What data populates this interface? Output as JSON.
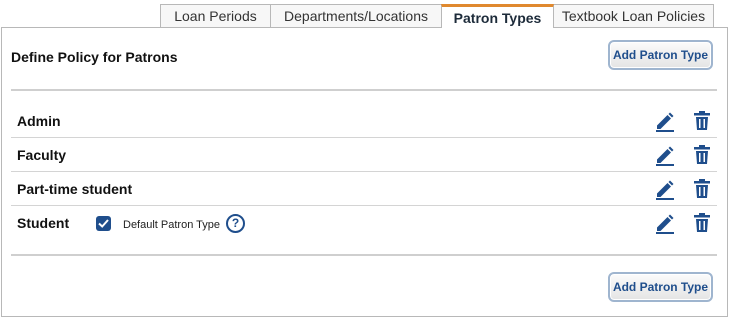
{
  "tabs": [
    {
      "label": "Loan Periods",
      "active": false
    },
    {
      "label": "Departments/Locations",
      "active": false
    },
    {
      "label": "Patron Types",
      "active": true
    },
    {
      "label": "Textbook Loan Policies",
      "active": false
    }
  ],
  "panel": {
    "title": "Define Policy for Patrons",
    "add_button_top": "Add Patron Type",
    "add_button_bottom": "Add Patron Type"
  },
  "patron_types": [
    {
      "name": "Admin",
      "is_default": false
    },
    {
      "name": "Faculty",
      "is_default": false
    },
    {
      "name": "Part-time student",
      "is_default": false
    },
    {
      "name": "Student",
      "is_default": true
    }
  ],
  "default_label": "Default Patron Type",
  "help_glyph": "?",
  "icons": {
    "edit": "pencil-icon",
    "delete": "trash-icon",
    "help": "question-circle-icon",
    "check": "checkmark-icon"
  },
  "colors": {
    "accent": "#1f4e8c",
    "active_tab_border": "#e0892e"
  }
}
